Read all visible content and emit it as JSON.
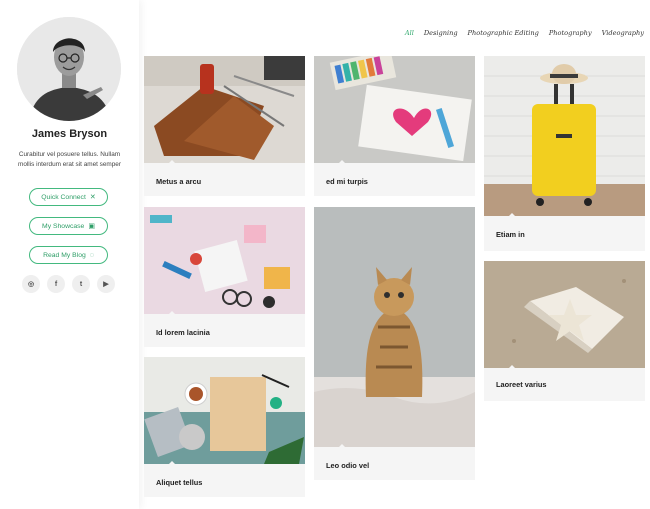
{
  "profile": {
    "name": "James Bryson",
    "bio": "Curabitur vel posuere tellus. Nullam mollis interdum erat sit amet semper",
    "buttons": [
      {
        "label": "Quick Connect",
        "icon": "connect-icon"
      },
      {
        "label": "My Showcase",
        "icon": "image-icon"
      },
      {
        "label": "Read My Blog",
        "icon": "loading-icon"
      }
    ],
    "socials": [
      {
        "name": "instagram-icon",
        "glyph": "◎"
      },
      {
        "name": "facebook-icon",
        "glyph": "f"
      },
      {
        "name": "twitter-icon",
        "glyph": "t"
      },
      {
        "name": "youtube-icon",
        "glyph": "▶"
      }
    ]
  },
  "filters": {
    "items": [
      "All",
      "Designing",
      "Photographic Editing",
      "Photography",
      "Videography"
    ],
    "active": "All"
  },
  "gallery": {
    "items": [
      {
        "title": "Metus a arcu"
      },
      {
        "title": "ed mi turpis"
      },
      {
        "title": "Etiam in"
      },
      {
        "title": "Id lorem lacinia"
      },
      {
        "title": "Leo odio vel"
      },
      {
        "title": "Laoreet varius"
      },
      {
        "title": "Aliquet tellus"
      }
    ]
  },
  "colors": {
    "accent": "#2ea86c",
    "card_bg": "#f5f5f5"
  }
}
